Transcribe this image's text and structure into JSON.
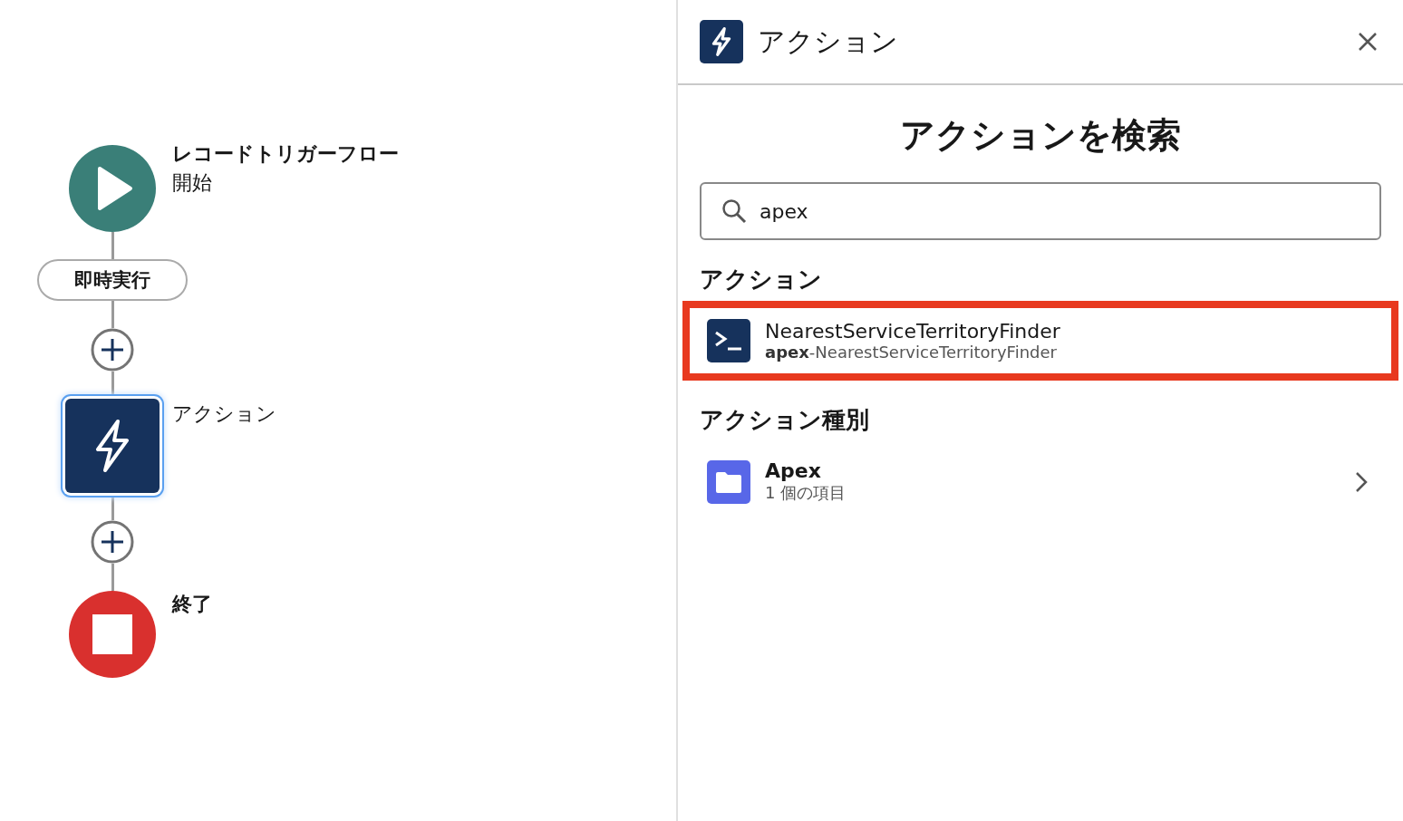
{
  "flow": [
    {
      "kind": "start",
      "title": "レコードトリガーフロー",
      "subtitle": "開始"
    },
    {
      "kind": "trigger",
      "label": "即時実行"
    },
    {
      "kind": "add"
    },
    {
      "kind": "action",
      "label": "アクション",
      "selected": true
    },
    {
      "kind": "add"
    },
    {
      "kind": "end",
      "label": "終了"
    }
  ],
  "panel": {
    "title": "アクション",
    "heading": "アクションを検索",
    "search": {
      "value": "apex"
    },
    "sections": [
      {
        "title": "アクション",
        "items": [
          {
            "kind": "apex",
            "title": "NearestServiceTerritoryFinder",
            "subtitle": "**apex**-NearestServiceTerritoryFinder",
            "highlighted": true
          }
        ]
      },
      {
        "title": "アクション種別",
        "items": [
          {
            "kind": "folder",
            "title": "Apex",
            "subtitle": "1 個の項目",
            "highlighted": false
          }
        ]
      }
    ]
  }
}
